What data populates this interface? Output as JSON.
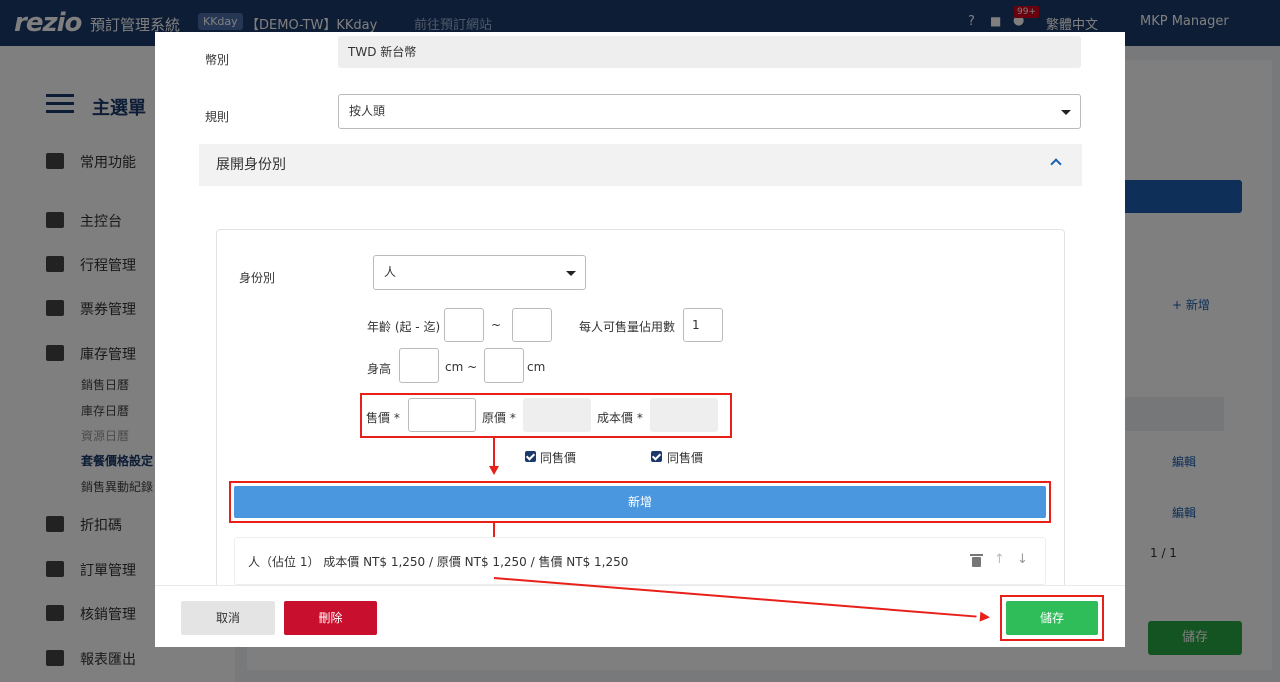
{
  "topbar": {
    "logo": "rezio",
    "app_name": "預訂管理系統",
    "store_badge": "KKday",
    "store_name": "【DEMO-TW】KKday",
    "goto_site": "前往預訂網站",
    "notification_count": "99+",
    "language": "繁體中文",
    "user": "MKP Manager"
  },
  "sidebar": {
    "heading": "主選單",
    "items": [
      {
        "label": "常用功能"
      },
      {
        "label": "主控台"
      },
      {
        "label": "行程管理"
      },
      {
        "label": "票券管理"
      },
      {
        "label": "庫存管理"
      },
      {
        "label": "折扣碼"
      },
      {
        "label": "訂單管理"
      },
      {
        "label": "核銷管理"
      },
      {
        "label": "報表匯出"
      }
    ],
    "sub_items": [
      {
        "label": "銷售日曆"
      },
      {
        "label": "庫存日曆"
      },
      {
        "label": "資源日曆"
      },
      {
        "label": "套餐價格設定"
      },
      {
        "label": "銷售異動紀錄"
      }
    ]
  },
  "background": {
    "add_link": "+ 新增",
    "edit_link": "編輯",
    "pager": "1 / 1",
    "save_button": "儲存"
  },
  "modal": {
    "currency_label": "幣別",
    "currency_value": "TWD 新台幣",
    "rule_label": "規則",
    "rule_value": "按人頭",
    "section_title": "展開身份別",
    "identity_label": "身份別",
    "identity_value": "人",
    "age_label": "年齡 (起 - 迄)",
    "age_sep": "~",
    "seats_label": "每人可售量佔用數",
    "seats_value": "1",
    "height_label": "身高",
    "height_unit_mid": "cm ~",
    "height_unit_end": "cm",
    "sale_price_label": "售價 *",
    "original_price_label": "原價 *",
    "cost_price_label": "成本價 *",
    "same_as_sale_1": "同售價",
    "same_as_sale_2": "同售價",
    "add_button": "新增",
    "result_row": "人（佔位 1） 成本價 NT$ 1,250 / 原價 NT$ 1,250 / 售價 NT$ 1,250",
    "footer": {
      "cancel": "取消",
      "delete": "刪除",
      "save": "儲存"
    }
  },
  "colors": {
    "topbar": "#1b3a6b",
    "primary_blue": "#4a97e0",
    "delete_red": "#c8102e",
    "save_green": "#2ebd59",
    "annotation_red": "#e8201a"
  }
}
